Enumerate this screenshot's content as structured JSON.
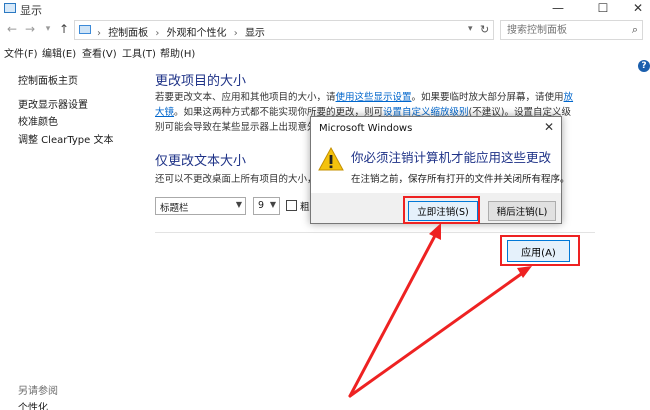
{
  "window": {
    "title": "显示",
    "minimize": "—",
    "maximize": "☐",
    "close": "✕"
  },
  "address": {
    "crumbs": [
      "控制面板",
      "外观和个性化",
      "显示"
    ],
    "separator": "›",
    "search_placeholder": "搜索控制面板"
  },
  "menubar": [
    "文件(F)",
    "编辑(E)",
    "查看(V)",
    "工具(T)",
    "帮助(H)"
  ],
  "sidebar": {
    "items": [
      "控制面板主页",
      "更改显示器设置",
      "校准颜色",
      "调整 ClearType 文本"
    ],
    "see_also": "另请参阅",
    "personalize": "个性化"
  },
  "main": {
    "heading1": "更改项目的大小",
    "desc_part1": "若要更改文本、应用和其他项目的大小，请",
    "link1": "使用这些显示设置",
    "desc_part2": "。如果要临时放大部分屏幕，请使用",
    "link2": "放大镜",
    "desc_part3": "。如果这两种方式都不能实现你所要的更改，则可",
    "link3": "设置自定义缩放级别",
    "desc_part4": "(不建议)。设置自定义级别可能会导致在某些显示器上出现意外行为。",
    "heading2": "仅更改文本大小",
    "desc2": "还可以不更改桌面上所有项目的大小，只",
    "item_select": "标题栏",
    "size_select": "9",
    "bold_label": "粗",
    "apply_label": "应用(A)"
  },
  "dialog": {
    "title": "Microsoft Windows",
    "close": "✕",
    "heading": "你必须注销计算机才能应用这些更改",
    "body": "在注销之前，保存所有打开的文件并关闭所有程序。",
    "signout_label": "立即注销(S)",
    "later_label": "稍后注销(L)"
  },
  "icons": {
    "back": "back-arrow-icon",
    "forward": "forward-arrow-icon",
    "up": "up-arrow-icon",
    "refresh": "refresh-icon",
    "search": "search-icon",
    "warning": "warning-icon",
    "help": "help-icon"
  },
  "colors": {
    "heading": "#1e3287",
    "link": "#0066cc",
    "annotation": "#ee2222",
    "accent": "#0078d7",
    "warning": "#f4c20d"
  }
}
